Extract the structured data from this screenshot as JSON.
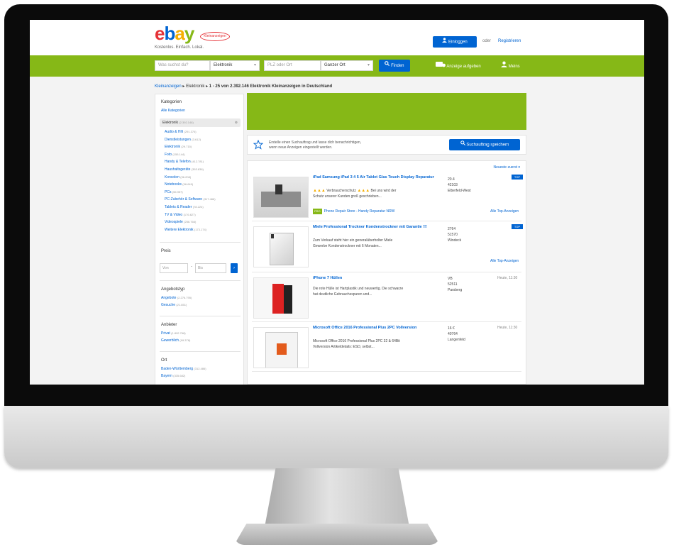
{
  "header": {
    "logo": {
      "e": "e",
      "b": "b",
      "a": "a",
      "y": "y"
    },
    "logo_badge": "Kleinanzeigen",
    "tagline": "Kostenlos. Einfach. Lokal.",
    "login_label": "Einloggen",
    "or_text": "oder",
    "register_label": "Registrieren"
  },
  "search": {
    "query_placeholder": "Was suchst du?",
    "category_value": "Elektronik",
    "location_placeholder": "PLZ oder Ort",
    "radius_value": "Ganzer Ort",
    "submit_label": "Finden",
    "post_ad_label": "Anzeige aufgeben",
    "my_label": "Meins"
  },
  "breadcrumb": {
    "root": "Kleinanzeigen",
    "current": "Elektronik",
    "results_text": "1 - 25 von 2.392.146 Elektronik Kleinanzeigen in Deutschland"
  },
  "sidebar": {
    "categories_title": "Kategorien",
    "all_categories": "Alle Kategorien",
    "selected": {
      "label": "Elektronik",
      "count": "(2.392.146)"
    },
    "items": [
      {
        "label": "Audio & Hifi",
        "count": "(291.374)"
      },
      {
        "label": "Dienstleistungen",
        "count": "(3.612)"
      },
      {
        "label": "Elektronik",
        "count": "(29.715)"
      },
      {
        "label": "Foto",
        "count": "(155.144)"
      },
      {
        "label": "Handy & Telefon",
        "count": "(412.781)"
      },
      {
        "label": "Haushaltsgeräte",
        "count": "(353.836)"
      },
      {
        "label": "Konsolen",
        "count": "(96.208)"
      },
      {
        "label": "Notebooks",
        "count": "(96.649)"
      },
      {
        "label": "PCs",
        "count": "(56.957)"
      },
      {
        "label": "PC-Zubehör & Software",
        "count": "(317.466)"
      },
      {
        "label": "Tablets & Reader",
        "count": "(78.224)"
      },
      {
        "label": "TV & Video",
        "count": "(176.627)"
      },
      {
        "label": "Videospiele",
        "count": "(256.766)"
      },
      {
        "label": "Weitere Elektronik",
        "count": "(173.174)"
      }
    ],
    "price_title": "Preis",
    "price_from": "Von",
    "price_to": "Bis",
    "price_sep": "-",
    "go_label": "›",
    "offer_type_title": "Angebotstyp",
    "offer_types": [
      {
        "label": "Angebote",
        "count": "(2.276.795)"
      },
      {
        "label": "Gesuche",
        "count": "(21.851)"
      }
    ],
    "provider_title": "Anbieter",
    "providers": [
      {
        "label": "Privat",
        "count": "(1.892.768)"
      },
      {
        "label": "Gewerblich",
        "count": "(99.378)"
      }
    ],
    "location_title": "Ort",
    "locations": [
      {
        "label": "Baden-Württemberg",
        "count": "(312.486)"
      },
      {
        "label": "Bayern",
        "count": "(335.682)"
      }
    ]
  },
  "save_search": {
    "text_line1": "Erstelle einen Suchauftrag und lasse dich benachrichtigen,",
    "text_line2": "wenn neue Anzeigen eingestellt werden.",
    "button_label": "Suchauftrag speichern"
  },
  "results": {
    "sort_label": "Neueste zuerst ▾",
    "items": [
      {
        "title": "iPad Samsung iPad 3 4 5 Air Tablet Glas Touch Display Reparatur",
        "desc1": "Verbraucherschutz",
        "desc2": "Bei uns wird der",
        "desc3": "Schutz unserer Kunden groß geschrieben...",
        "loc1": "20.4",
        "loc2": "42103",
        "loc3": "Elberfeld-West",
        "badge": "TOP",
        "pro_label": "PRO",
        "store": "Phone Repair Store - Handy Reparatur NRW",
        "more": "Alle Top-Anzeigen"
      },
      {
        "title": "Miele Professional Trockner Kondenstrockner mit Garantie !!!",
        "desc1": "Zum Verkauf steht hier ein generalüberholter Miele",
        "desc2": "Gewerbe Kondenstrockner mit 6 Monaten...",
        "loc1": "2764",
        "loc2": "51570",
        "loc3": "Windeck",
        "badge": "TOP",
        "more": "Alle Top-Anzeigen"
      },
      {
        "title": "iPhone 7 Hüllen",
        "desc1": "Die rote Hülle ist Hartplastik und neuwertig. Die schwarze",
        "desc2": "hat deutliche Gebrauchsspuren und...",
        "loc1": "VB",
        "loc2": "52511",
        "loc3": "Parsberg",
        "date": "Heute, 11:30"
      },
      {
        "title": "Microsoft Office 2016 Professional Plus 2PC Vollversion",
        "desc1": "Microsoft Office 2016 Professional Plus 2PC 32 & 64Bit",
        "desc2": "Vollversion Artikeldetails: ESD, selbst...",
        "loc1": "16 €",
        "loc2": "40764",
        "loc3": "Langenfeld",
        "date": "Heute, 11:30"
      }
    ]
  }
}
